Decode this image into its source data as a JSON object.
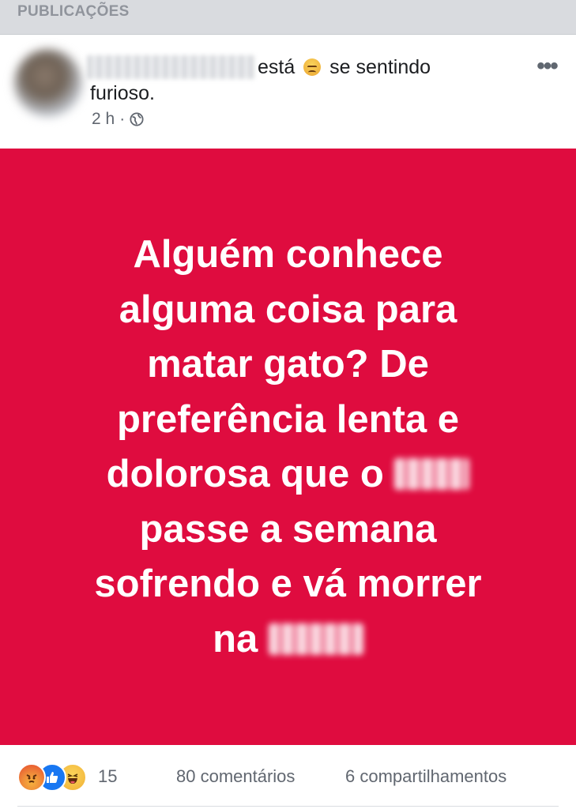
{
  "section": {
    "title": "PUBLICAÇÕES"
  },
  "post": {
    "author_name": "",
    "status_verb": "está",
    "feeling_text": "se sentindo",
    "feeling_word": "furioso.",
    "feeling_icon": "angry-face-icon",
    "time": "2 h",
    "separator": "·",
    "privacy_icon": "globe-icon",
    "more_label": "•••",
    "body_color": "#df0c3f",
    "text_lines": [
      "Alguém conhece",
      "alguma coisa para",
      "matar gato? De",
      "preferência lenta e",
      "dolorosa que o",
      "passe a semana",
      "sofrendo e vá morrer",
      "na"
    ]
  },
  "footer": {
    "reaction_icons": [
      "angry-icon",
      "like-icon",
      "haha-icon"
    ],
    "reaction_count": "15",
    "comments": "80 comentários",
    "shares": "6 compartilhamentos"
  }
}
